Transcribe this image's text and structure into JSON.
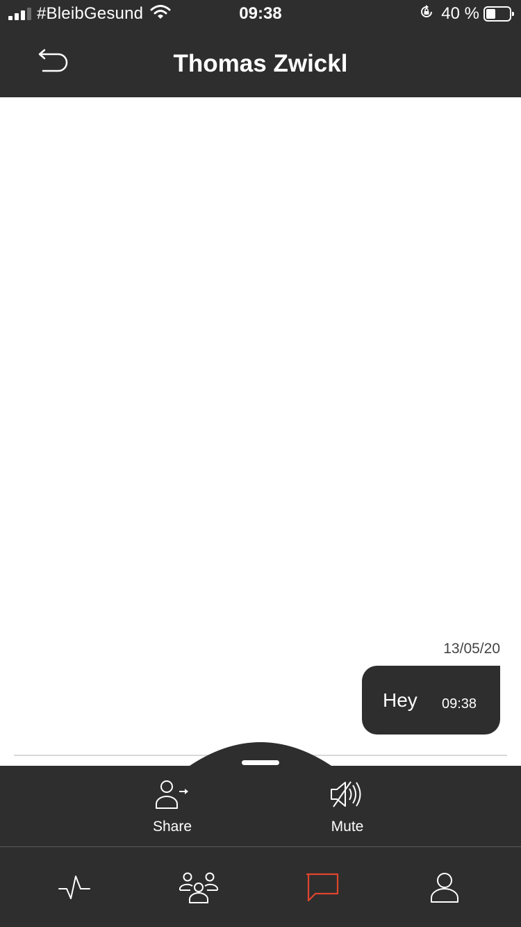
{
  "status_bar": {
    "carrier": "#BleibGesund",
    "time": "09:38",
    "battery": "40 %",
    "battery_level": 0.4
  },
  "header": {
    "title": "Thomas Zwickl",
    "back_icon": "undo-arrow-icon"
  },
  "chat": {
    "date": "13/05/20",
    "messages": [
      {
        "text": "Hey",
        "time": "09:38",
        "outgoing": true
      }
    ]
  },
  "actions": [
    {
      "label": "Share",
      "icon": "share-user-icon"
    },
    {
      "label": "Mute",
      "icon": "mute-speaker-icon"
    }
  ],
  "tabs": [
    {
      "icon": "activity-pulse-icon",
      "active": false
    },
    {
      "icon": "group-icon",
      "active": false
    },
    {
      "icon": "chat-bubble-icon",
      "active": true
    },
    {
      "icon": "profile-icon",
      "active": false
    }
  ],
  "colors": {
    "bar_background": "#2e2e2e",
    "active_tab": "#e0452d",
    "icon": "#ffffff"
  }
}
